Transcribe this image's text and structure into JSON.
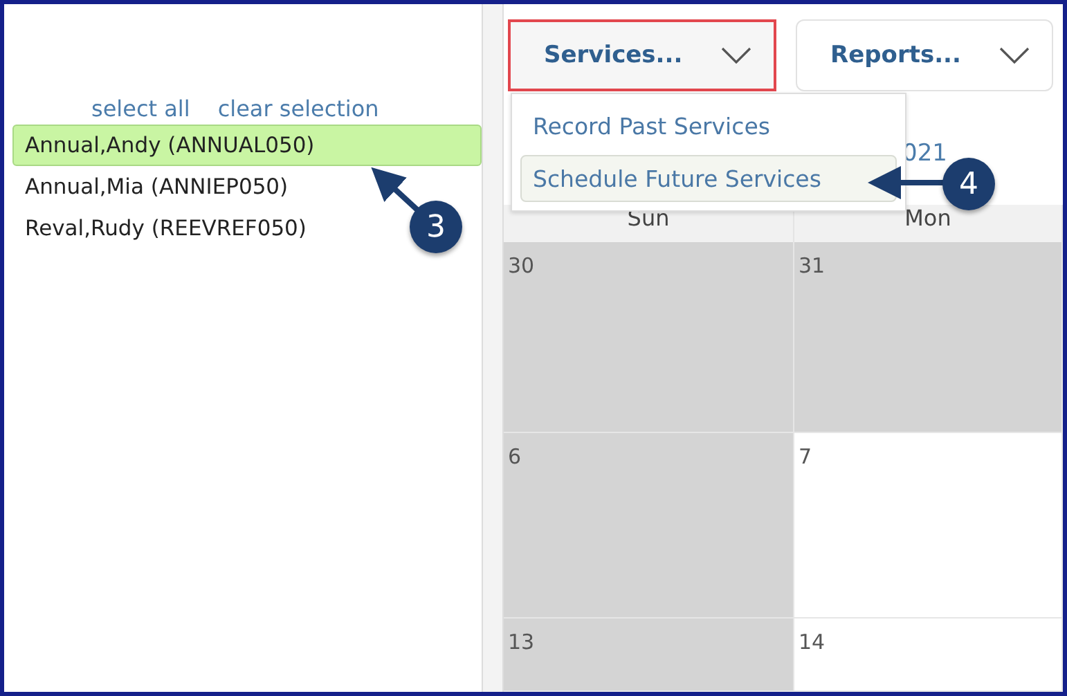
{
  "patient_panel": {
    "select_all": "select all",
    "clear_selection": "clear selection",
    "patients": [
      {
        "label": "Annual,Andy (ANNUAL050)",
        "selected": true
      },
      {
        "label": "Annual,Mia (ANNIEP050)",
        "selected": false
      },
      {
        "label": "Reval,Rudy (REEVREF050)",
        "selected": false
      }
    ]
  },
  "toolbar": [
    {
      "label": "Services...",
      "highlighted": true
    },
    {
      "label": "Reports...",
      "highlighted": false
    }
  ],
  "services_menu": [
    {
      "label": "Record Past Services",
      "hovered": false
    },
    {
      "label": "Schedule Future Services",
      "hovered": true
    }
  ],
  "calendar": {
    "title": "021",
    "weekdays": [
      "Sun",
      "Mon"
    ],
    "weeks": [
      [
        {
          "day": "30",
          "shaded": true
        },
        {
          "day": "31",
          "shaded": true
        }
      ],
      [
        {
          "day": "6",
          "shaded": true
        },
        {
          "day": "7",
          "shaded": false
        }
      ],
      [
        {
          "day": "13",
          "shaded": true
        },
        {
          "day": "14",
          "shaded": false
        }
      ]
    ]
  },
  "callouts": [
    "3",
    "4"
  ]
}
